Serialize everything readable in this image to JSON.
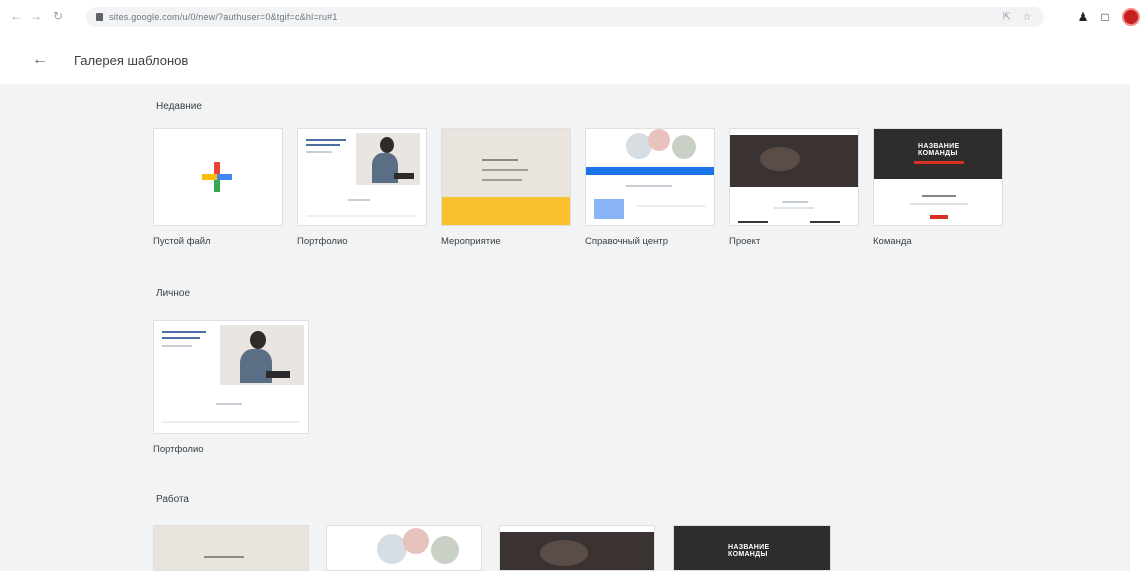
{
  "browser": {
    "url": "sites.google.com/u/0/new/?authuser=0&tgif=c&hl=ru#1",
    "nav": {
      "back_icon": "arrow-left-icon",
      "forward_icon": "arrow-right-icon",
      "reload_icon": "reload-icon"
    }
  },
  "header": {
    "title": "Галерея шаблонов",
    "back_icon": "arrow-left-icon"
  },
  "sections": [
    {
      "title": "Недавние",
      "templates": [
        {
          "label": "Пустой файл",
          "kind": "blank"
        },
        {
          "label": "Портфолио",
          "kind": "portfolio"
        },
        {
          "label": "Мероприятие",
          "kind": "event"
        },
        {
          "label": "Справочный центр",
          "kind": "help"
        },
        {
          "label": "Проект",
          "kind": "project"
        },
        {
          "label": "Команда",
          "kind": "team"
        }
      ]
    },
    {
      "title": "Личное",
      "templates": [
        {
          "label": "Портфолио",
          "kind": "portfolio"
        }
      ]
    },
    {
      "title": "Работа",
      "templates": [
        {
          "label": "",
          "kind": "event"
        },
        {
          "label": "",
          "kind": "help"
        },
        {
          "label": "",
          "kind": "project"
        },
        {
          "label": "",
          "kind": "team"
        }
      ]
    }
  ],
  "thumb_text": {
    "team_title": "НАЗВАНИЕ КОМАНДЫ"
  },
  "colors": {
    "accent_blue": "#1a73e8",
    "yellow": "#fbc02d",
    "gallery_bg": "#f1f3f4",
    "avatar": "#c5221f"
  }
}
